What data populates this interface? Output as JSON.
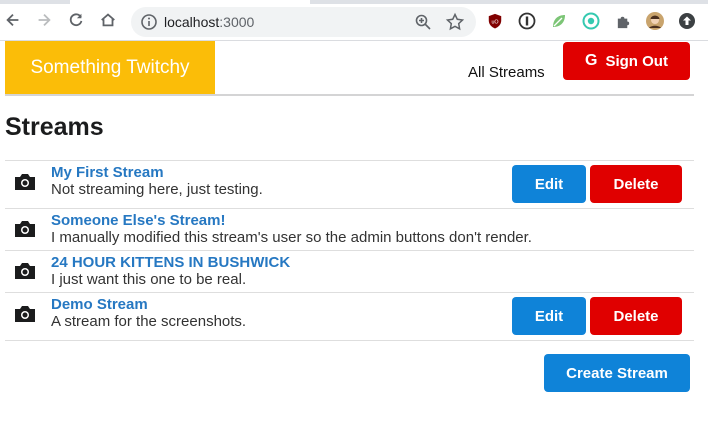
{
  "browser": {
    "url_host": "localhost",
    "url_port": ":3000"
  },
  "header": {
    "brand": "Something Twitchy",
    "nav_link": "All Streams",
    "signout_label": "Sign Out",
    "signout_icon_glyph": "G"
  },
  "page": {
    "title": "Streams"
  },
  "streams": [
    {
      "title": "My First Stream",
      "description": "Not streaming here, just testing.",
      "edit_label": "Edit",
      "delete_label": "Delete"
    },
    {
      "title": "Someone Else's Stream!",
      "description": "I manually modified this stream's user so the admin buttons don't render."
    },
    {
      "title": "24 HOUR KITTENS IN BUSHWICK",
      "description": "I just want this one to be real."
    },
    {
      "title": "Demo Stream",
      "description": "A stream for the screenshots.",
      "edit_label": "Edit",
      "delete_label": "Delete"
    }
  ],
  "footer": {
    "create_label": "Create Stream"
  },
  "colors": {
    "brand": "#fbbd08",
    "primary_button": "#0f83d8",
    "danger_button": "#e00000",
    "stream_link": "#2678c2"
  },
  "icons": [
    "back-arrow-icon",
    "forward-arrow-icon",
    "reload-icon",
    "home-icon",
    "info-icon",
    "zoom-icon",
    "star-icon",
    "ublock-icon",
    "extension-icon",
    "camera-icon",
    "google-icon"
  ]
}
